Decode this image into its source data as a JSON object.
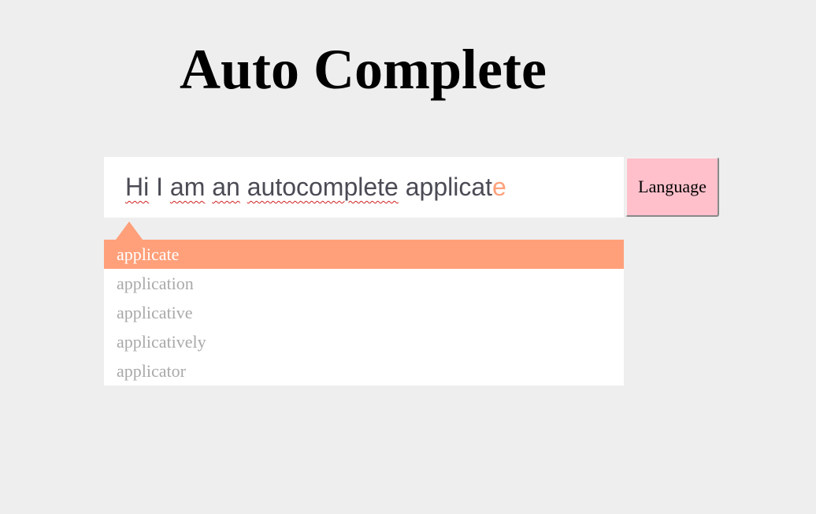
{
  "header": {
    "title": "Auto Complete"
  },
  "editor": {
    "words": [
      "Hi",
      "I",
      "am",
      "an",
      "autocomplete"
    ],
    "current_typed": "applicat",
    "completion_ghost": "e"
  },
  "language_button": {
    "label": "Language"
  },
  "suggestions": {
    "items": [
      "applicate",
      "application",
      "applicative",
      "applicatively",
      "applicator"
    ],
    "selected_index": 0
  },
  "colors": {
    "accent": "#ffa07a",
    "button_bg": "#ffc0cb",
    "page_bg": "#eeeeee",
    "suggestion_text": "#a9a9a9",
    "input_text": "#4b4b55"
  }
}
